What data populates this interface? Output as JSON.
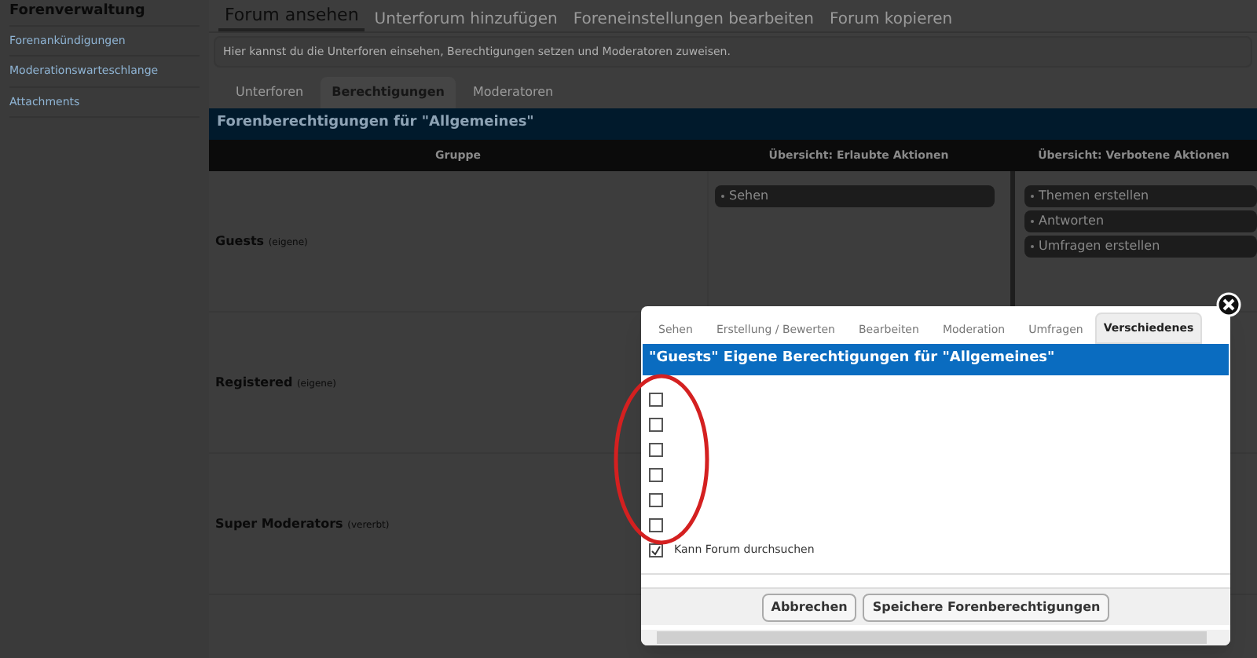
{
  "sidebar": {
    "title": "Forenverwaltung",
    "items": [
      {
        "label": "Forenankündigungen"
      },
      {
        "label": "Moderationswarteschlange"
      },
      {
        "label": "Attachments"
      }
    ]
  },
  "tabs": [
    {
      "label": "Forum ansehen",
      "selected": true
    },
    {
      "label": "Unterforum hinzufügen",
      "selected": false
    },
    {
      "label": "Foreneinstellungen bearbeiten",
      "selected": false
    },
    {
      "label": "Forum kopieren",
      "selected": false
    }
  ],
  "description": "Hier kannst du die Unterforen einsehen, Berechtigungen setzen und Moderatoren zuweisen.",
  "subtabs": [
    {
      "label": "Unterforen",
      "selected": false
    },
    {
      "label": "Berechtigungen",
      "selected": true
    },
    {
      "label": "Moderatoren",
      "selected": false
    }
  ],
  "table": {
    "title": "Forenberechtigungen für \"Allgemeines\"",
    "columns": [
      "Gruppe",
      "Übersicht: Erlaubte Aktionen",
      "Übersicht: Verbotene Aktionen"
    ],
    "rows": [
      {
        "group": "Guests",
        "note": "(eigene)",
        "allowed": [
          "Sehen"
        ],
        "forbidden": [
          "Themen erstellen",
          "Antworten",
          "Umfragen erstellen"
        ]
      },
      {
        "group": "Registered",
        "note": "(eigene)",
        "allowed": [],
        "forbidden": []
      },
      {
        "group": "Super Moderators",
        "note": "(vererbt)",
        "allowed": [],
        "forbidden": []
      }
    ]
  },
  "dialog": {
    "tabs": [
      {
        "label": "Sehen",
        "selected": false
      },
      {
        "label": "Erstellung / Bewerten",
        "selected": false
      },
      {
        "label": "Bearbeiten",
        "selected": false
      },
      {
        "label": "Moderation",
        "selected": false
      },
      {
        "label": "Umfragen",
        "selected": false
      },
      {
        "label": "Verschiedenes",
        "selected": true
      }
    ],
    "title": "\"Guests\" Eigene Berechtigungen für \"Allgemeines\"",
    "options": [
      {
        "checked": false
      },
      {
        "checked": false
      },
      {
        "checked": false
      },
      {
        "checked": false
      },
      {
        "checked": false
      },
      {
        "checked": false
      },
      {
        "label": "Kann Forum durchsuchen",
        "checked": true
      }
    ],
    "buttons": [
      "Abbrechen",
      "Speichere Forenberechtigungen"
    ]
  }
}
